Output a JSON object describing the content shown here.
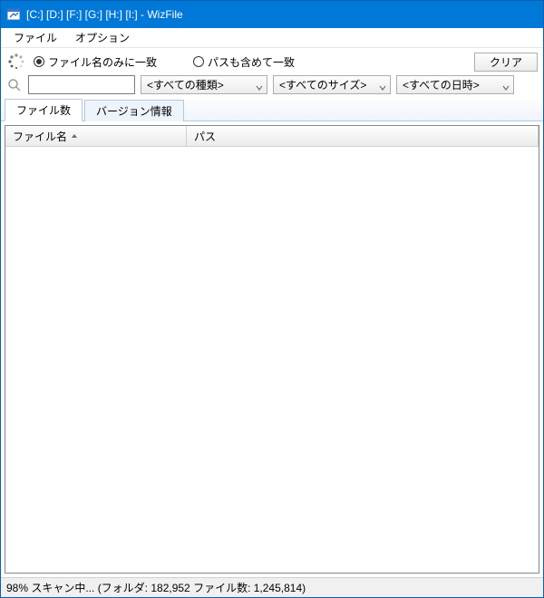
{
  "titlebar": {
    "title": "[C:] [D:] [F:] [G:] [H:] [I:]  - WizFile"
  },
  "menu": {
    "file": "ファイル",
    "options": "オプション"
  },
  "radios": {
    "filename_only": "ファイル名のみに一致",
    "include_path": "パスも含めて一致"
  },
  "buttons": {
    "clear": "クリア"
  },
  "filters": {
    "type": "<すべての種類>",
    "size": "<すべてのサイズ>",
    "date": "<すべての日時>"
  },
  "tabs": {
    "file_count": "ファイル数",
    "version_info": "バージョン情報"
  },
  "columns": {
    "filename": "ファイル名",
    "path": "パス"
  },
  "status": {
    "text": "98% スキャン中... (フォルダ: 182,952  ファイル数: 1,245,814)"
  }
}
